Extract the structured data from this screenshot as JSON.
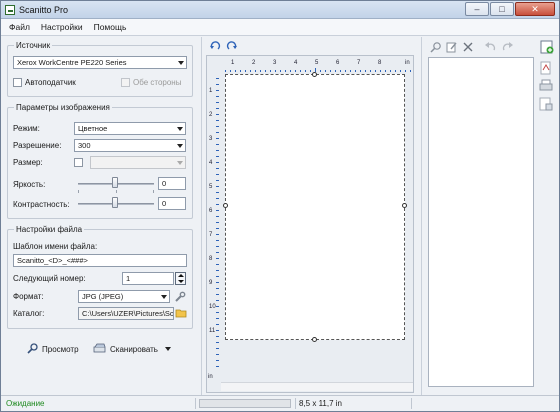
{
  "window": {
    "title": "Scanitto Pro"
  },
  "menu": [
    "Файл",
    "Настройки",
    "Помощь"
  ],
  "source": {
    "group_label": "Источник",
    "device": "Xerox WorkCentre PE220 Series",
    "adf_label": "Автоподатчик",
    "duplex_label": "Обе стороны"
  },
  "image": {
    "group_label": "Параметры изображения",
    "mode_label": "Режим:",
    "mode_value": "Цветное",
    "resolution_label": "Разрешение:",
    "resolution_value": "300",
    "size_label": "Размер:",
    "brightness_label": "Яркость:",
    "brightness_value": "0",
    "contrast_label": "Контрастность:",
    "contrast_value": "0"
  },
  "file": {
    "group_label": "Настройки файла",
    "template_label": "Шаблон имени файла:",
    "template_value": "Scanitto_<D>_<###>",
    "next_label": "Следующий номер:",
    "next_value": "1",
    "format_label": "Формат:",
    "format_value": "JPG (JPEG)",
    "folder_label": "Каталог:",
    "folder_value": "C:\\Users\\UZER\\Pictures\\Scanitto"
  },
  "actions": {
    "preview_label": "Просмотр",
    "scan_label": "Сканировать"
  },
  "ruler": {
    "top_unit": "in",
    "top_numbers": [
      "1",
      "2",
      "3",
      "4",
      "5",
      "6",
      "7",
      "8"
    ],
    "left_unit": "in",
    "left_numbers": [
      "1",
      "2",
      "3",
      "4",
      "5",
      "6",
      "7",
      "8",
      "9",
      "10",
      "11"
    ]
  },
  "status": {
    "state": "Ожидание",
    "page_size": "8,5 x 11,7 in",
    "progress": 0
  },
  "colors": {
    "status_green": "#1f8a1f",
    "accent_blue": "#2e63b8"
  }
}
